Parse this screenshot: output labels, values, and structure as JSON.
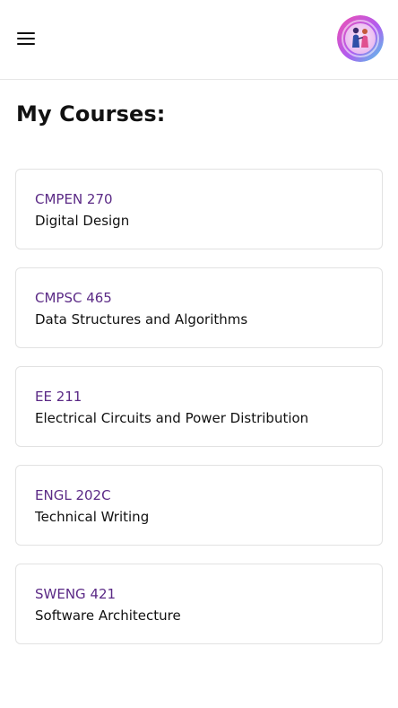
{
  "header": {
    "menu_icon": "hamburger-menu-icon",
    "avatar_icon": "user-avatar-icon"
  },
  "page": {
    "title": "My Courses:"
  },
  "courses": [
    {
      "code": "CMPEN 270",
      "name": "Digital Design"
    },
    {
      "code": "CMPSC 465",
      "name": "Data Structures and Algorithms"
    },
    {
      "code": "EE 211",
      "name": "Electrical Circuits and Power Distribution"
    },
    {
      "code": "ENGL 202C",
      "name": "Technical Writing"
    },
    {
      "code": "SWENG 421",
      "name": "Software Architecture"
    }
  ],
  "colors": {
    "course_code": "#5b2a86",
    "text": "#111111",
    "card_border": "#e2e2e2",
    "avatar_gradient": [
      "#f04fb0",
      "#b05cf0",
      "#4fd0e8"
    ]
  }
}
